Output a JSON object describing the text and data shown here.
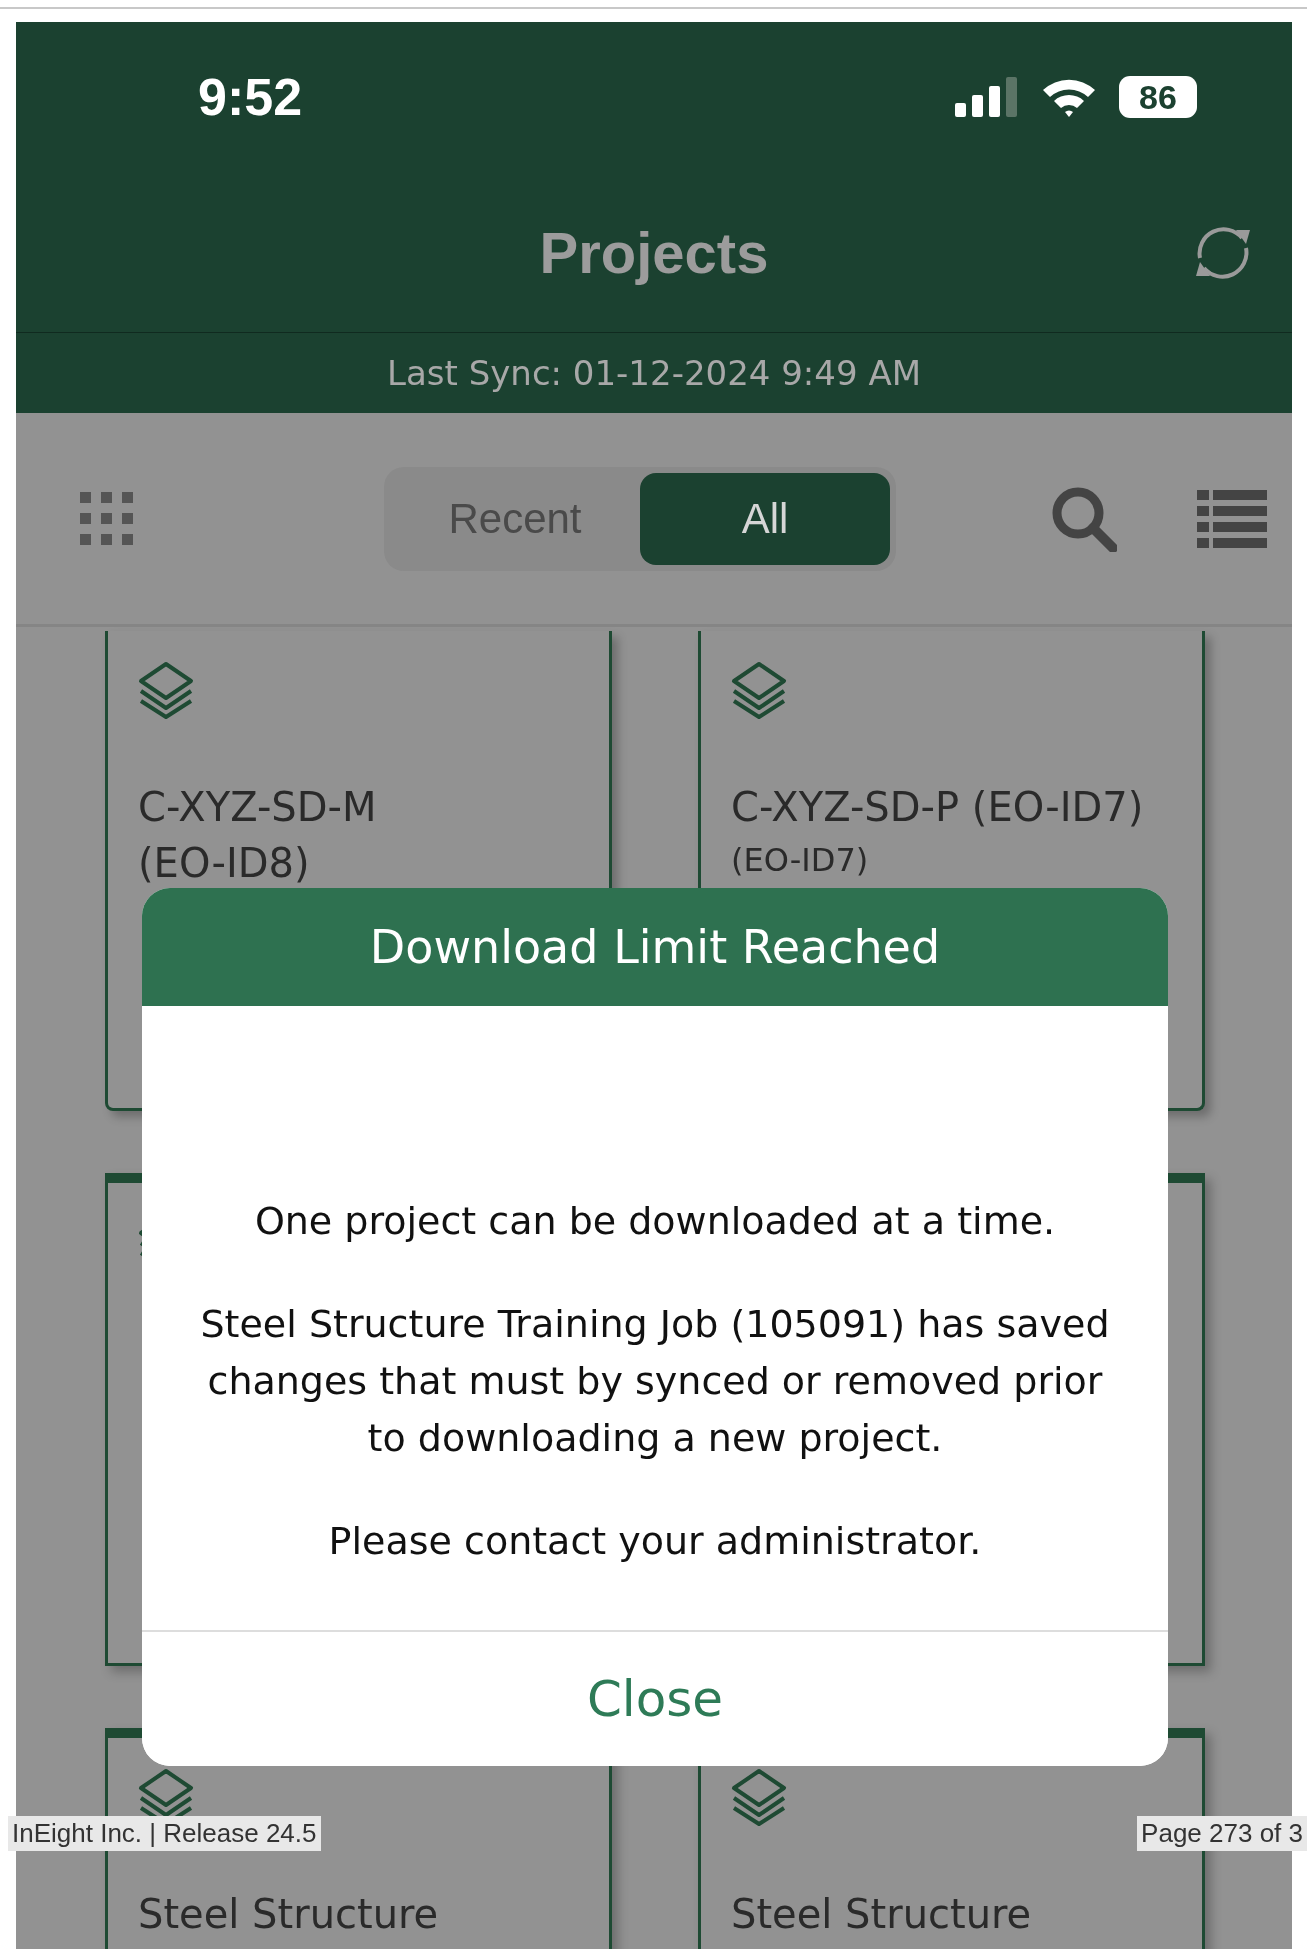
{
  "status_bar": {
    "time": "9:52",
    "battery": "86"
  },
  "header": {
    "title": "Projects",
    "last_sync": "Last Sync: 01-12-2024 9:49 AM"
  },
  "tabs": [
    {
      "label": "Recent",
      "selected": false
    },
    {
      "label": "All",
      "selected": true
    }
  ],
  "cards": [
    {
      "lines": [
        "C-XYZ-SD-M",
        "(EO-ID8)"
      ],
      "top_bar": false
    },
    {
      "lines": [
        "C-XYZ-SD-P (EO-ID7)"
      ],
      "subtitle": "(EO-ID7)",
      "top_bar": false
    },
    {
      "top_bar": true
    },
    {
      "top_bar": true
    },
    {
      "lines": [
        "Steel Structure"
      ],
      "top_bar": true
    },
    {
      "lines": [
        "Steel Structure"
      ],
      "top_bar": true
    }
  ],
  "dialog": {
    "title": "Download Limit Reached",
    "paragraphs": [
      "One project can be downloaded at a time.",
      "Steel Structure Training Job (105091) has saved changes that must by synced or removed prior to downloading a new project.",
      "Please contact your administrator."
    ],
    "button": "Close"
  },
  "footer": {
    "left": "InEight Inc. | Release 24.5",
    "right": "Page 273 of 3"
  }
}
